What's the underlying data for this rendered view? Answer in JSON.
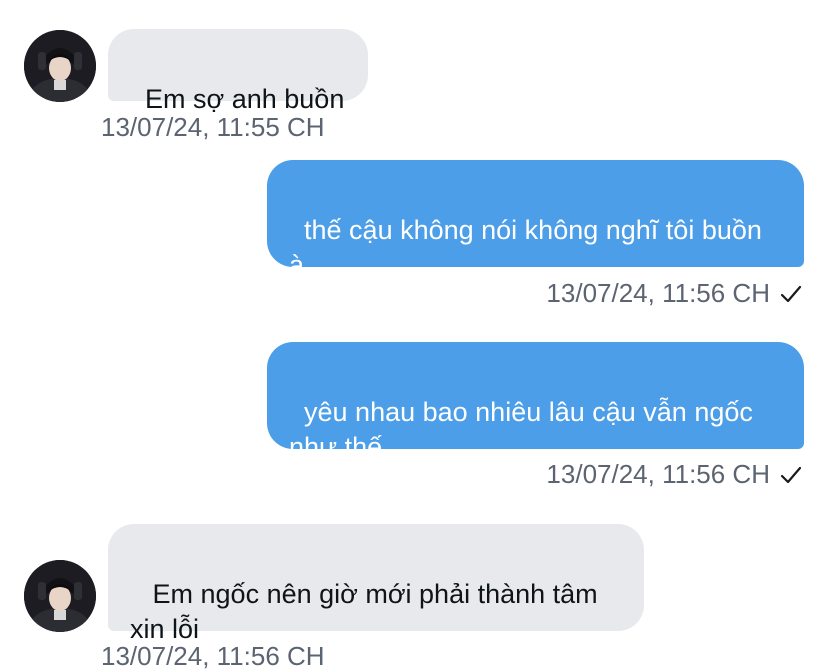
{
  "conversation": {
    "accent_color": "#4c9ee8",
    "incoming_bubble_color": "#e7e9ec",
    "messages": [
      {
        "direction": "incoming",
        "text": "Em sợ anh buồn",
        "timestamp": "13/07/24, 11:55 CH"
      },
      {
        "direction": "outgoing",
        "text": "thế cậu không nói không nghĩ tôi buồn à",
        "timestamp": "13/07/24, 11:56 CH",
        "status_icon": "checkmark-icon"
      },
      {
        "direction": "outgoing",
        "text": "yêu nhau bao nhiêu lâu cậu vẫn ngốc như thế",
        "timestamp": "13/07/24, 11:56 CH",
        "status_icon": "checkmark-icon"
      },
      {
        "direction": "incoming",
        "text": " Em ngốc nên giờ mới phải thành tâm xin lỗi",
        "timestamp": "13/07/24, 11:56 CH"
      }
    ]
  }
}
